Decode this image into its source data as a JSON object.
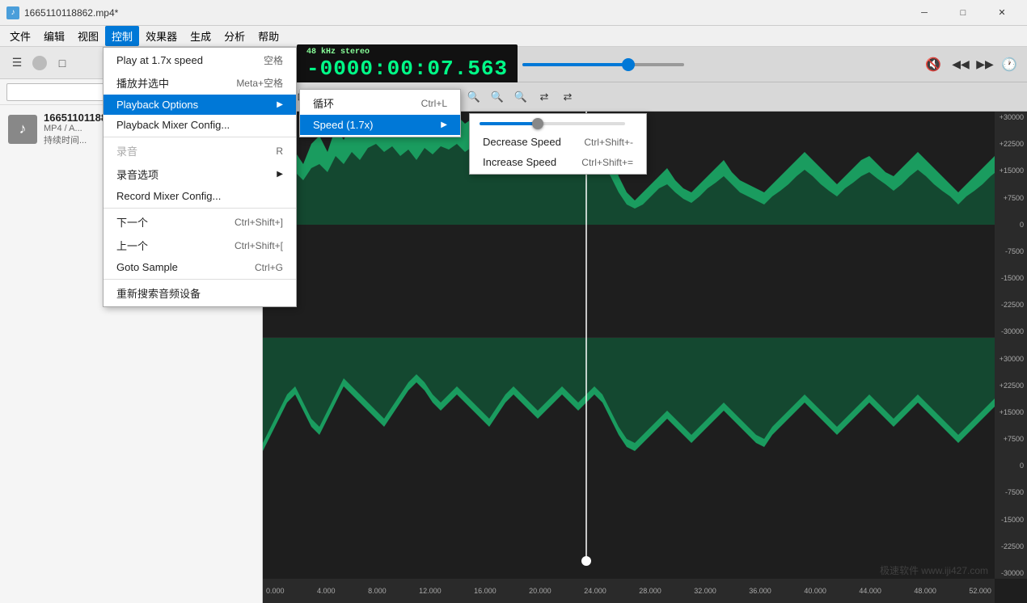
{
  "title": {
    "text": "1665110118862.mp4*",
    "icon": "♪"
  },
  "titlebar_controls": {
    "minimize": "─",
    "maximize": "□",
    "close": "✕"
  },
  "menubar": {
    "items": [
      "文件",
      "编辑",
      "视图",
      "控制",
      "效果器",
      "生成",
      "分析",
      "帮助"
    ]
  },
  "sidebar": {
    "search_placeholder": "",
    "toolbar_btns": [
      "☰",
      "●",
      "□"
    ]
  },
  "file_item": {
    "name": "1665110118862",
    "type": "MP4 / A...",
    "duration": "持续时间..."
  },
  "control_menu": {
    "items": [
      {
        "label": "Play at 1.7x speed",
        "shortcut": "空格",
        "disabled": false,
        "has_submenu": false
      },
      {
        "label": "播放并选中",
        "shortcut": "Meta+空格",
        "disabled": false,
        "has_submenu": false
      },
      {
        "label": "Playback Options",
        "shortcut": "",
        "disabled": false,
        "has_submenu": true,
        "highlighted": true
      },
      {
        "label": "Playback Mixer Config...",
        "shortcut": "",
        "disabled": false,
        "has_submenu": false
      },
      {
        "separator": true
      },
      {
        "label": "录音",
        "shortcut": "R",
        "disabled": true,
        "has_submenu": false
      },
      {
        "label": "录音选项",
        "shortcut": "",
        "disabled": false,
        "has_submenu": true
      },
      {
        "label": "Record Mixer Config...",
        "shortcut": "",
        "disabled": false,
        "has_submenu": false
      },
      {
        "separator": true
      },
      {
        "label": "下一个",
        "shortcut": "Ctrl+Shift+]",
        "disabled": false,
        "has_submenu": false
      },
      {
        "label": "上一个",
        "shortcut": "Ctrl+Shift+[",
        "disabled": false,
        "has_submenu": false
      },
      {
        "label": "Goto Sample",
        "shortcut": "Ctrl+G",
        "disabled": false,
        "has_submenu": false
      },
      {
        "separator": true
      },
      {
        "label": "重新搜索音频设备",
        "shortcut": "",
        "disabled": false,
        "has_submenu": false
      }
    ]
  },
  "playback_options_submenu": {
    "items": [
      {
        "label": "循环",
        "shortcut": "Ctrl+L"
      },
      {
        "label": "Speed (1.7x)",
        "shortcut": "",
        "has_submenu": true,
        "highlighted": true
      }
    ]
  },
  "speed_submenu": {
    "items": [
      {
        "label": "Decrease Speed",
        "shortcut": "Ctrl+Shift+-"
      },
      {
        "label": "Increase Speed",
        "shortcut": "Ctrl+Shift+="
      }
    ],
    "slider_value": 38
  },
  "player": {
    "freq": "48 kHz",
    "channels": "stereo",
    "time": "-0000:00:07.563",
    "volume": 65
  },
  "scale_labels": [
    "+30000",
    "+22500",
    "+15000",
    "+7500",
    "0",
    "-7500",
    "-15000",
    "-22500",
    "-30000",
    "+30000",
    "+22500",
    "+15000",
    "+7500",
    "0",
    "-7500",
    "-15000",
    "-22500",
    "-30000",
    "-30000"
  ],
  "timeline_labels": [
    "0.000",
    "4.000",
    "8.000",
    "12.000",
    "16.000",
    "20.000",
    "24.000",
    "28.000",
    "32.000",
    "36.000",
    "40.000",
    "44.000",
    "48.000",
    "52.000"
  ],
  "watermark": "极速软件 www.iji427.com"
}
